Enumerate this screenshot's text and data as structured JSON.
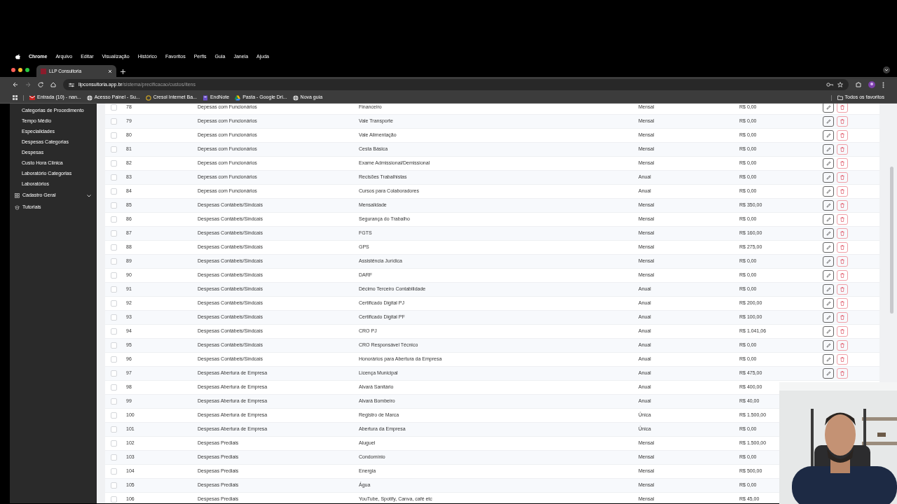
{
  "menu_bar": {
    "items": [
      "Chrome",
      "Arquivo",
      "Editar",
      "Visualização",
      "Histórico",
      "Favoritos",
      "Perfis",
      "Guia",
      "Janela",
      "Ajuda"
    ]
  },
  "browser": {
    "tab": {
      "title": "LLP Consultoria"
    },
    "url": {
      "host": "llpconsultoria.app.br",
      "path": "/sistema/precificacao/custos/itens"
    },
    "bookmarks": [
      {
        "label": "Entrada (10) - nan...",
        "kind": "mail"
      },
      {
        "label": "Acesso Painel - Su...",
        "kind": "globe"
      },
      {
        "label": "Cresol Internet Ba...",
        "kind": "ring"
      },
      {
        "label": "EndNote",
        "kind": "note"
      },
      {
        "label": "Pasta - Google Dri...",
        "kind": "drive"
      },
      {
        "label": "Nova guia",
        "kind": "globe"
      }
    ],
    "bookmarks_folder": "Todos os favoritos"
  },
  "sidebar": {
    "items": [
      {
        "label": "Categorias de Procedimento",
        "kind": "link"
      },
      {
        "label": "Tempo Médio",
        "kind": "link"
      },
      {
        "label": "Especialidades",
        "kind": "link"
      },
      {
        "label": "Despesas Categorias",
        "kind": "link"
      },
      {
        "label": "Despesas",
        "kind": "link"
      },
      {
        "label": "Custo Hora Clínica",
        "kind": "link"
      },
      {
        "label": "Laboratório Categorias",
        "kind": "link"
      },
      {
        "label": "Laboratórios",
        "kind": "link"
      },
      {
        "label": "Cadastro Geral",
        "kind": "group"
      },
      {
        "label": "Tutoriais",
        "kind": "page"
      }
    ]
  },
  "table": {
    "rows": [
      {
        "id": "78",
        "category": "Depesas com Funcionários",
        "item": "Financeiro",
        "frequency": "Mensal",
        "value": "R$ 0,00",
        "checked": false
      },
      {
        "id": "79",
        "category": "Depesas com Funcionários",
        "item": "Vale Transporte",
        "frequency": "Mensal",
        "value": "R$ 0,00",
        "checked": false
      },
      {
        "id": "80",
        "category": "Depesas com Funcionários",
        "item": "Vale Alimentação",
        "frequency": "Mensal",
        "value": "R$ 0,00",
        "checked": false
      },
      {
        "id": "81",
        "category": "Depesas com Funcionários",
        "item": "Cesta Básica",
        "frequency": "Mensal",
        "value": "R$ 0,00",
        "checked": false
      },
      {
        "id": "82",
        "category": "Depesas com Funcionários",
        "item": "Exame Admissional/Demissional",
        "frequency": "Mensal",
        "value": "R$ 0,00",
        "checked": false
      },
      {
        "id": "83",
        "category": "Depesas com Funcionários",
        "item": "Recisões Trabalhistas",
        "frequency": "Anual",
        "value": "R$ 0,00",
        "checked": false
      },
      {
        "id": "84",
        "category": "Depesas com Funcionários",
        "item": "Cursos para Colaboradores",
        "frequency": "Anual",
        "value": "R$ 0,00",
        "checked": false
      },
      {
        "id": "85",
        "category": "Despesas Contábeis/Sindcais",
        "item": "Mensalidade",
        "frequency": "Mensal",
        "value": "R$ 350,00",
        "checked": false
      },
      {
        "id": "86",
        "category": "Despesas Contábeis/Sindcais",
        "item": "Segurança do Trabalho",
        "frequency": "Mensal",
        "value": "R$ 0,00",
        "checked": false
      },
      {
        "id": "87",
        "category": "Despesas Contábeis/Sindcais",
        "item": "FGTS",
        "frequency": "Mensal",
        "value": "R$ 160,00",
        "checked": false
      },
      {
        "id": "88",
        "category": "Despesas Contábeis/Sindcais",
        "item": "GPS",
        "frequency": "Mensal",
        "value": "R$ 275,00",
        "checked": false
      },
      {
        "id": "89",
        "category": "Despesas Contábeis/Sindcais",
        "item": "Assistência Jurídica",
        "frequency": "Mensal",
        "value": "R$ 0,00",
        "checked": false
      },
      {
        "id": "90",
        "category": "Despesas Contábeis/Sindcais",
        "item": "DARF",
        "frequency": "Mensal",
        "value": "R$ 0,00",
        "checked": false
      },
      {
        "id": "91",
        "category": "Despesas Contábeis/Sindcais",
        "item": "Décimo Terceiro Contabilidade",
        "frequency": "Anual",
        "value": "R$ 0,00",
        "checked": false
      },
      {
        "id": "92",
        "category": "Despesas Contábeis/Sindcais",
        "item": "Certificado Digital PJ",
        "frequency": "Anual",
        "value": "R$ 200,00",
        "checked": false
      },
      {
        "id": "93",
        "category": "Despesas Contábeis/Sindcais",
        "item": "Certificado Digital PF",
        "frequency": "Anual",
        "value": "R$ 100,00",
        "checked": false
      },
      {
        "id": "94",
        "category": "Despesas Contábeis/Sindcais",
        "item": "CRO PJ",
        "frequency": "Anual",
        "value": "R$ 1.041,06",
        "checked": false
      },
      {
        "id": "95",
        "category": "Despesas Contábeis/Sindcais",
        "item": "CRO Responsável Técnico",
        "frequency": "Anual",
        "value": "R$ 0,00",
        "checked": false
      },
      {
        "id": "96",
        "category": "Despesas Contábeis/Sindcais",
        "item": "Honorários para Abertura da Empresa",
        "frequency": "Anual",
        "value": "R$ 0,00",
        "checked": false
      },
      {
        "id": "97",
        "category": "Despesas Abertura de Empresa",
        "item": "Licença Municipal",
        "frequency": "Anual",
        "value": "R$ 475,00",
        "checked": false
      },
      {
        "id": "98",
        "category": "Despesas Abertura de Empresa",
        "item": "Alvará Sanitário",
        "frequency": "Anual",
        "value": "R$ 400,00",
        "checked": false
      },
      {
        "id": "99",
        "category": "Despesas Abertura de Empresa",
        "item": "Alvará Bombeiro",
        "frequency": "Anual",
        "value": "R$ 40,00",
        "checked": false
      },
      {
        "id": "100",
        "category": "Despesas Abertura de Empresa",
        "item": "Registro de Marca",
        "frequency": "Única",
        "value": "R$ 1.500,00",
        "checked": false
      },
      {
        "id": "101",
        "category": "Despesas Abertura de Empresa",
        "item": "Abertura da Empresa",
        "frequency": "Única",
        "value": "R$ 0,00",
        "checked": false
      },
      {
        "id": "102",
        "category": "Despesas Prediais",
        "item": "Aluguel",
        "frequency": "Mensal",
        "value": "R$ 1.500,00",
        "checked": false
      },
      {
        "id": "103",
        "category": "Despesas Prediais",
        "item": "Condomínio",
        "frequency": "Mensal",
        "value": "R$ 0,00",
        "checked": false
      },
      {
        "id": "104",
        "category": "Despesas Prediais",
        "item": "Energia",
        "frequency": "Mensal",
        "value": "R$ 500,00",
        "checked": false
      },
      {
        "id": "105",
        "category": "Despesas Prediais",
        "item": "Água",
        "frequency": "Mensal",
        "value": "R$ 0,00",
        "checked": false
      },
      {
        "id": "106",
        "category": "Despesas Prediais",
        "item": "YouTube, Spotify, Canva, café etc",
        "frequency": "Mensal",
        "value": "R$ 45,00",
        "checked": false
      }
    ]
  }
}
